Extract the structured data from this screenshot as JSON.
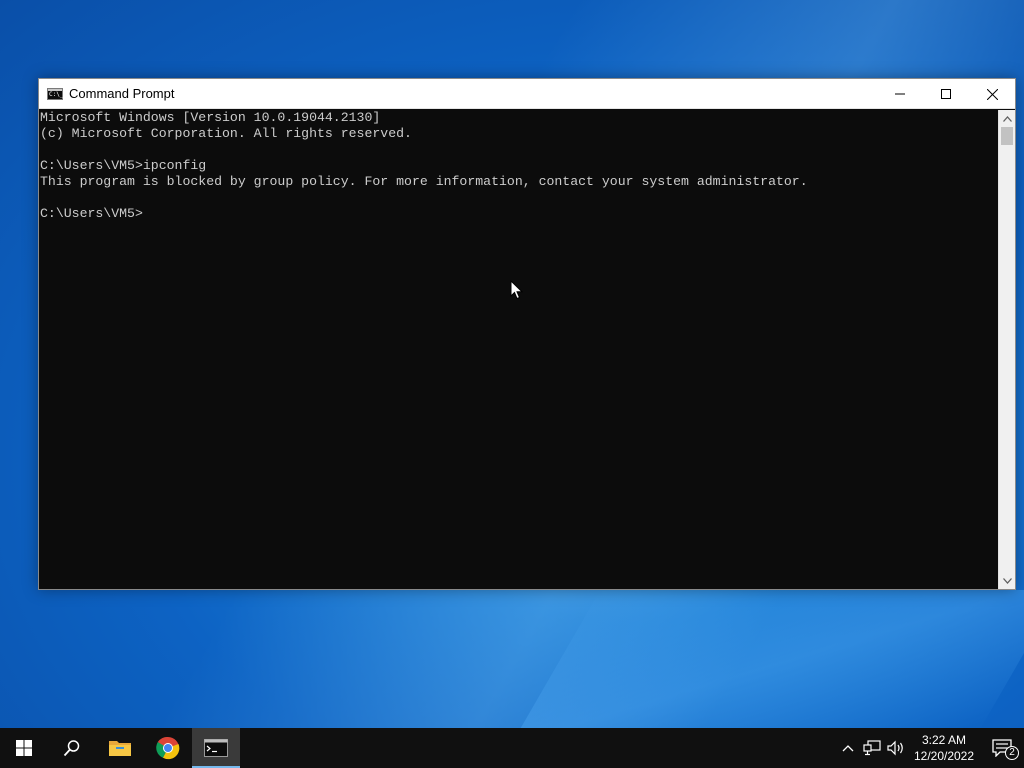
{
  "window": {
    "title": "Command Prompt",
    "icon_text": "C:\\_"
  },
  "console": {
    "lines": [
      "Microsoft Windows [Version 10.0.19044.2130]",
      "(c) Microsoft Corporation. All rights reserved.",
      "",
      "C:\\Users\\VM5>ipconfig",
      "This program is blocked by group policy. For more information, contact your system administrator.",
      "",
      "C:\\Users\\VM5>"
    ]
  },
  "taskbar": {
    "items": [
      "start",
      "search",
      "file-explorer",
      "chrome",
      "command-prompt"
    ],
    "active": "command-prompt",
    "clock": {
      "time": "3:22 AM",
      "date": "12/20/2022"
    },
    "notification_count": "2"
  },
  "colors": {
    "console_bg": "#0c0c0c",
    "console_fg": "#cccccc",
    "taskbar_bg": "#101010",
    "accent": "#76b9ed"
  },
  "icons": {
    "minimize": "minimize-icon",
    "maximize": "maximize-icon",
    "close": "close-icon",
    "start": "windows-logo-icon",
    "search": "search-icon",
    "file_explorer": "folder-icon",
    "chrome": "chrome-icon",
    "cmd": "terminal-icon",
    "tray_chevron": "chevron-up-icon",
    "network": "network-icon",
    "volume": "speaker-icon",
    "notifications": "notification-icon"
  }
}
